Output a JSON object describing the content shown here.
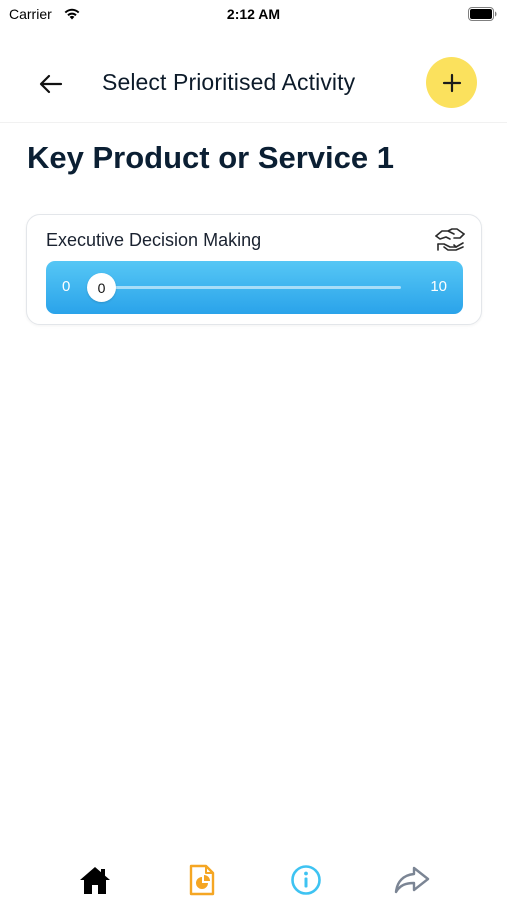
{
  "status_bar": {
    "carrier": "Carrier",
    "time": "2:12 AM"
  },
  "header": {
    "title": "Select Prioritised Activity",
    "back_icon": "arrow-left-icon",
    "add_icon": "plus-icon",
    "add_color": "#fbe15d"
  },
  "section": {
    "title": "Key Product or Service 1"
  },
  "activity": {
    "name": "Executive Decision Making",
    "icon": "handshake-icon",
    "slider": {
      "min_label": "0",
      "max_label": "10",
      "value_label": "0",
      "value": 0,
      "min": 0,
      "max": 10,
      "color": "#2aa3ea"
    }
  },
  "bottom_nav": {
    "items": [
      {
        "icon": "home-icon",
        "color": "#000000"
      },
      {
        "icon": "report-icon",
        "color": "#f5a623"
      },
      {
        "icon": "info-icon",
        "color": "#3ec3f2"
      },
      {
        "icon": "share-icon",
        "color": "#7b8594"
      }
    ]
  }
}
